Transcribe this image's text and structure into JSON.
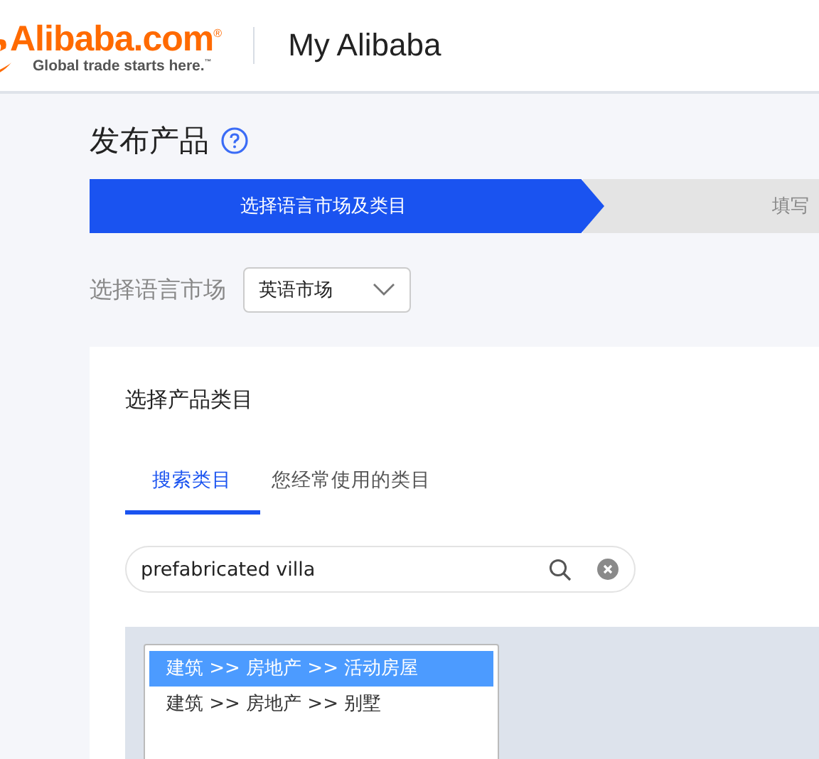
{
  "header": {
    "logo": "Alibaba.com$^{®}$",
    "tagline": "Global trade starts here.$^{™}$",
    "title": "My Alibaba"
  },
  "page_title": "发布产品",
  "steps": [
    {
      "label": "选择语言市场及类目",
      "selected": true
    },
    {
      "label": "填写",
      "selected": false
    }
  ],
  "market": {
    "label": "选择语言市场",
    "value": "英语市场"
  },
  "category_card": {
    "title": "选择产品类目",
    "tabs": [
      {
        "label": "搜索类目",
        "selected": true
      },
      {
        "label": "您经常使用的类目",
        "selected": false
      }
    ],
    "search": {
      "value": "prefabricated villa"
    },
    "results": [
      {
        "label": "建筑 >> 房地产 >> 活动房屋",
        "selected": true
      },
      {
        "label": "建筑 >> 房地产 >> 别墅",
        "selected": false
      }
    ]
  }
}
